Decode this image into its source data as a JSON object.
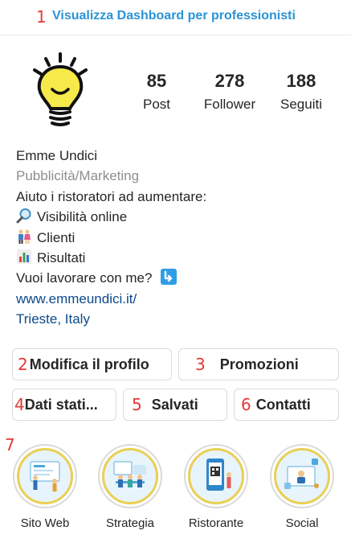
{
  "dashboard": {
    "marker": "1",
    "label": "Visualizza Dashboard per professionisti"
  },
  "stats": [
    {
      "value": "85",
      "label": "Post"
    },
    {
      "value": "278",
      "label": "Follower"
    },
    {
      "value": "188",
      "label": "Seguiti"
    }
  ],
  "profile": {
    "name": "Emme Undici",
    "category": "Pubblicità/Marketing",
    "bio_lines": [
      {
        "icon": "",
        "text": "Aiuto i ristoratori ad aumentare:"
      },
      {
        "icon": "magnifying-glass-icon",
        "text": "Visibilità online"
      },
      {
        "icon": "couple-icon",
        "text": "Clienti"
      },
      {
        "icon": "bar-chart-icon",
        "text": "Risultati"
      },
      {
        "icon": "arrow-down-right-icon",
        "text": "Vuoi lavorare con me?"
      }
    ],
    "website": "www.emmeundici.it/",
    "location": "Trieste, Italy"
  },
  "buttons": {
    "edit": {
      "marker": "2",
      "label": "Modifica il profilo"
    },
    "promotions": {
      "marker": "3",
      "label": "Promozioni"
    },
    "insights": {
      "marker": "4",
      "label": "Dati stati..."
    },
    "saved": {
      "marker": "5",
      "label": "Salvati"
    },
    "contacts": {
      "marker": "6",
      "label": "Contatti"
    }
  },
  "highlights": {
    "marker": "7",
    "items": [
      {
        "label": "Sito Web"
      },
      {
        "label": "Strategia"
      },
      {
        "label": "Ristorante"
      },
      {
        "label": "Social"
      }
    ]
  },
  "colors": {
    "accent_blue": "#2a93d6",
    "link_blue": "#0b4a8a",
    "marker_red": "#e53935",
    "muted_gray": "#8e8e8e",
    "highlight_ring_gold": "#e9cf55"
  }
}
